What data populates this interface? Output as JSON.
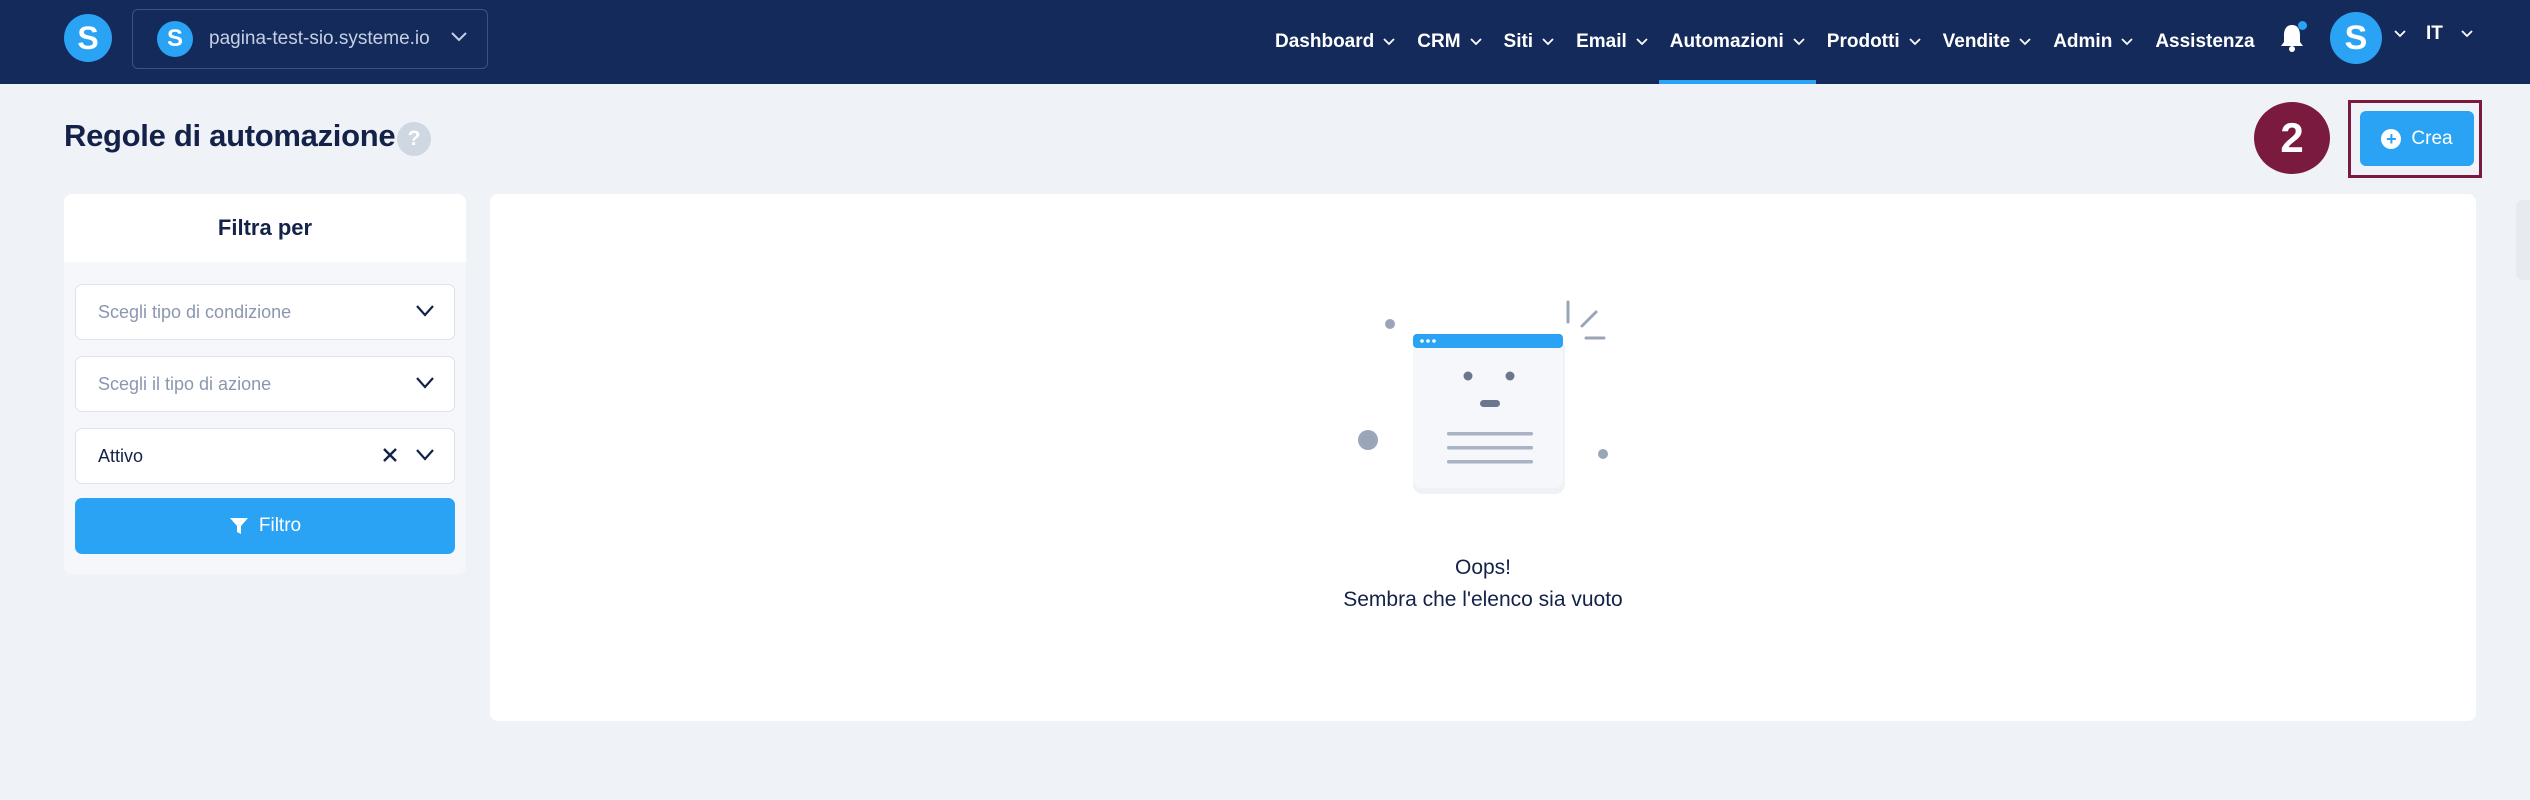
{
  "brand": {
    "logo_letter": "S",
    "accent_color": "#2aa3f4",
    "nav_bg": "#142a5a",
    "badge_color": "#7a1a3e"
  },
  "site_selector": {
    "letter": "S",
    "domain": "pagina-test-sio.systeme.io"
  },
  "nav": {
    "items": [
      {
        "label": "Dashboard",
        "dropdown": true
      },
      {
        "label": "CRM",
        "dropdown": true
      },
      {
        "label": "Siti",
        "dropdown": true
      },
      {
        "label": "Email",
        "dropdown": true
      },
      {
        "label": "Automazioni",
        "dropdown": true,
        "active": true
      },
      {
        "label": "Prodotti",
        "dropdown": true
      },
      {
        "label": "Vendite",
        "dropdown": true
      },
      {
        "label": "Admin",
        "dropdown": true
      },
      {
        "label": "Assistenza",
        "dropdown": false
      }
    ],
    "avatar_letter": "S",
    "language": "IT"
  },
  "page": {
    "title": "Regole di automazione",
    "help_glyph": "?",
    "step_badge": "2",
    "create_label": "Crea"
  },
  "filter": {
    "heading": "Filtra per",
    "condition_placeholder": "Scegli tipo di condizione",
    "action_placeholder": "Scegli il tipo di azione",
    "status_value": "Attivo",
    "button_label": "Filtro"
  },
  "empty_state": {
    "title": "Oops!",
    "message": "Sembra che l'elenco sia vuoto"
  }
}
